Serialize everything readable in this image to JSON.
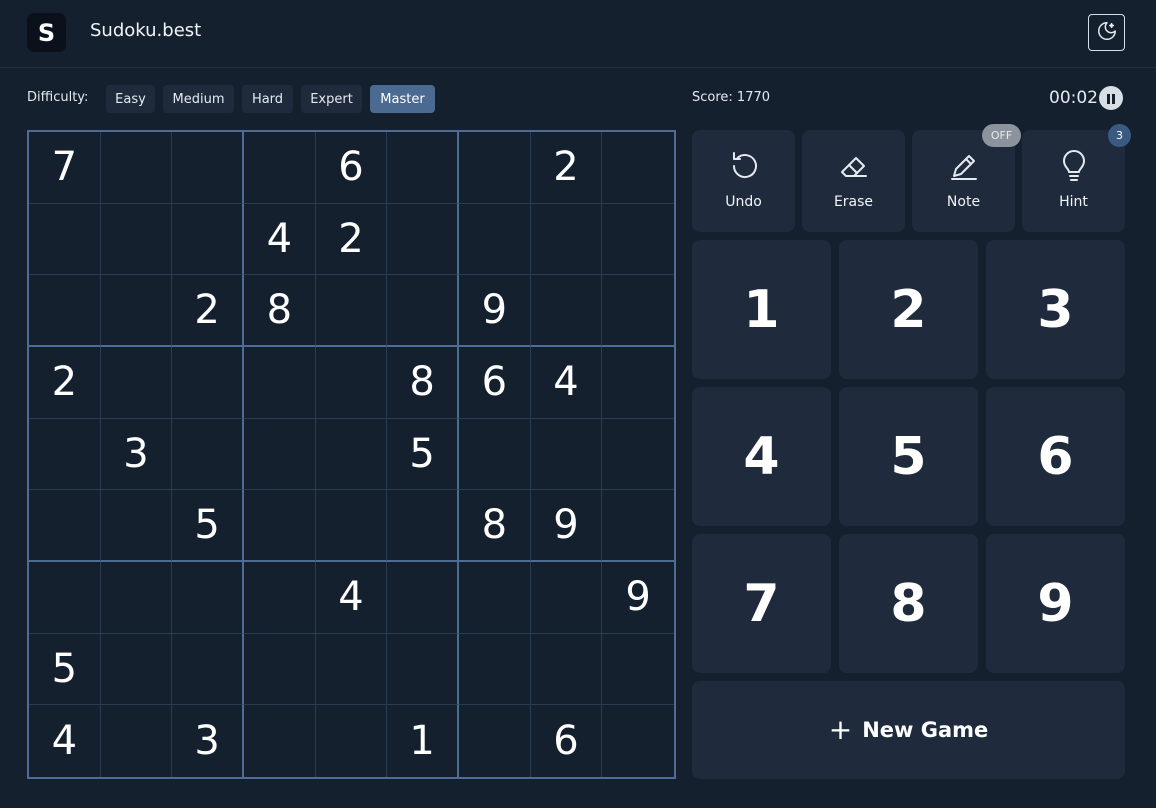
{
  "header": {
    "logo_letter": "S",
    "title": "Sudoku.best",
    "theme_icon": "moon-stars-icon"
  },
  "toolbar": {
    "difficulty_label": "Difficulty:",
    "difficulties": [
      "Easy",
      "Medium",
      "Hard",
      "Expert",
      "Master"
    ],
    "active_difficulty": "Master",
    "score_text": "Score: 1770",
    "timer": "00:02",
    "pause_icon": "pause-icon"
  },
  "board": {
    "rows": [
      [
        "7",
        "",
        "",
        "",
        "6",
        "",
        "",
        "2",
        ""
      ],
      [
        "",
        "",
        "",
        "4",
        "2",
        "",
        "",
        "",
        ""
      ],
      [
        "",
        "",
        "2",
        "8",
        "",
        "",
        "9",
        "",
        ""
      ],
      [
        "2",
        "",
        "",
        "",
        "",
        "8",
        "6",
        "4",
        ""
      ],
      [
        "",
        "3",
        "",
        "",
        "",
        "5",
        "",
        "",
        ""
      ],
      [
        "",
        "",
        "5",
        "",
        "",
        "",
        "8",
        "9",
        ""
      ],
      [
        "",
        "",
        "",
        "",
        "4",
        "",
        "",
        "",
        "9"
      ],
      [
        "5",
        "",
        "",
        "",
        "",
        "",
        "",
        "",
        ""
      ],
      [
        "4",
        "",
        "3",
        "",
        "",
        "1",
        "",
        "6",
        ""
      ]
    ]
  },
  "tools": {
    "undo_label": "Undo",
    "erase_label": "Erase",
    "note_label": "Note",
    "hint_label": "Hint",
    "note_badge": "OFF",
    "hint_badge": "3"
  },
  "numpad": [
    "1",
    "2",
    "3",
    "4",
    "5",
    "6",
    "7",
    "8",
    "9"
  ],
  "new_game": {
    "plus": "+",
    "label": "New Game"
  },
  "colors": {
    "background": "#15202f",
    "panel": "#1f2b3c",
    "active_difficulty": "#4b6a92",
    "board_border": "#4d6d94"
  }
}
